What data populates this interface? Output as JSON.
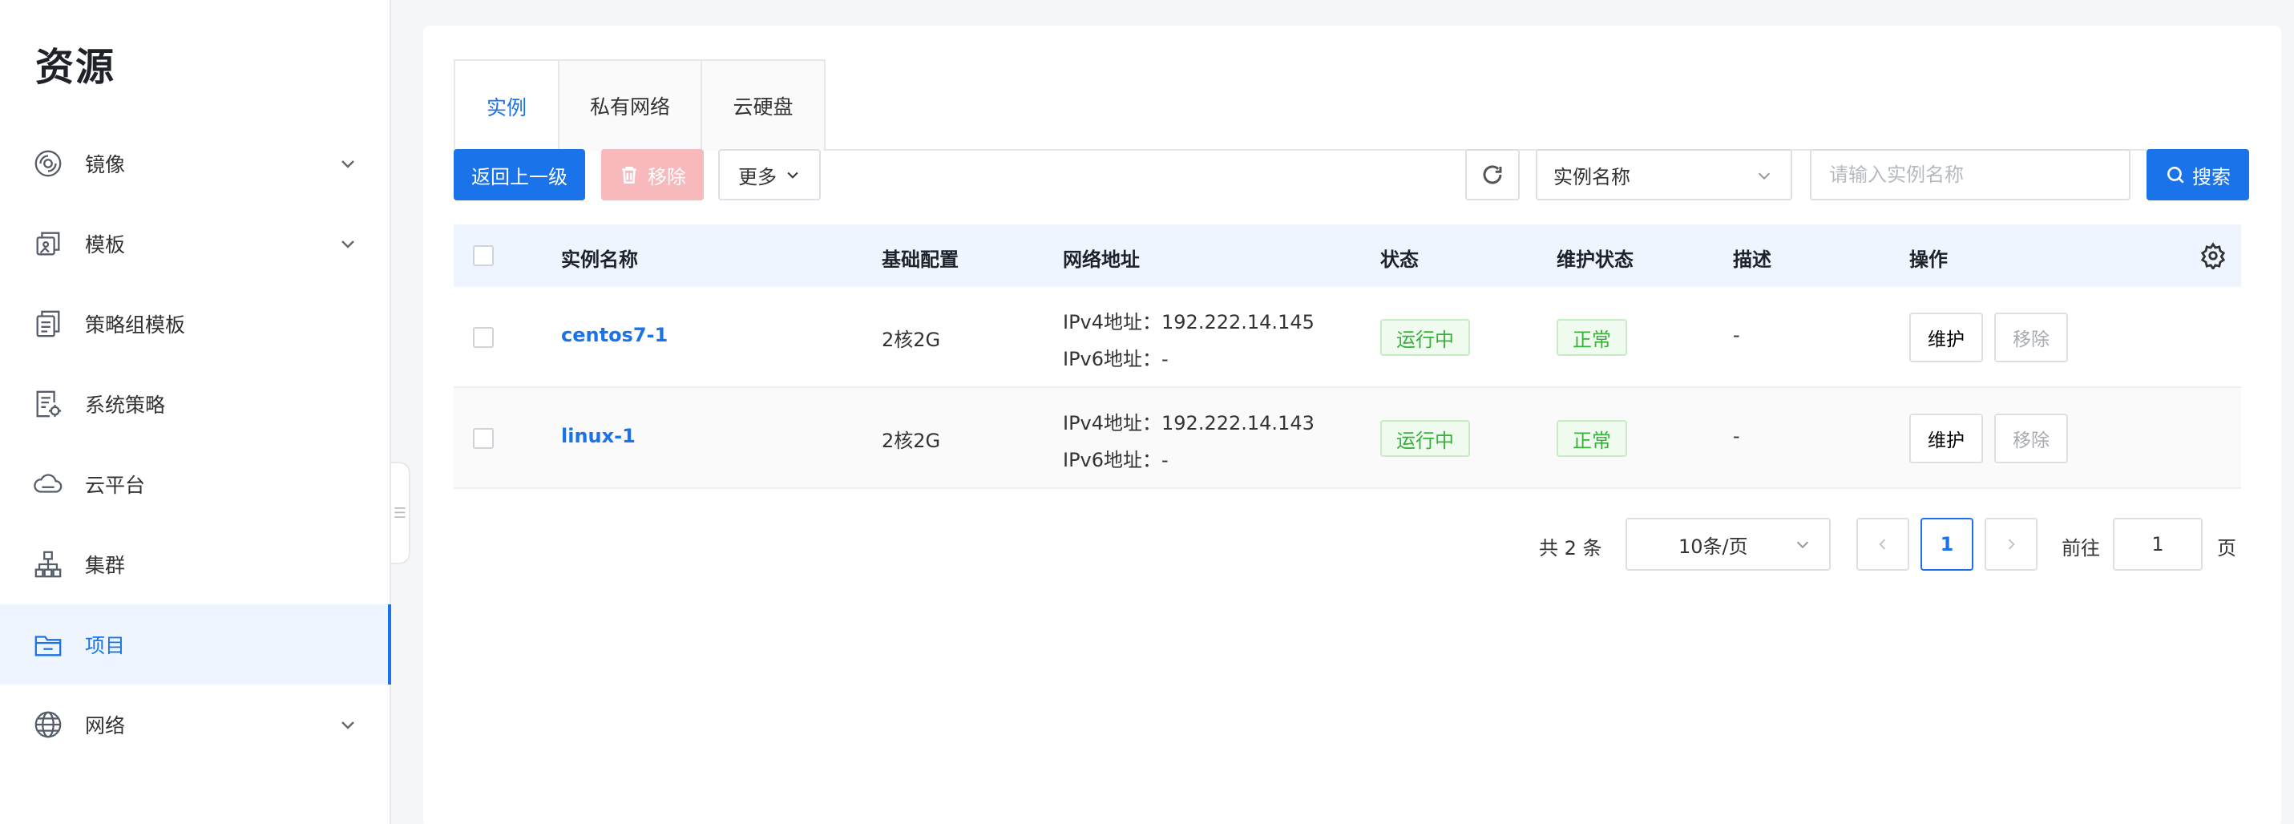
{
  "sidebar": {
    "title": "资源",
    "items": [
      {
        "label": "镜像",
        "icon": "disc-icon",
        "has_arrow": true
      },
      {
        "label": "模板",
        "icon": "template-icon",
        "has_arrow": true
      },
      {
        "label": "策略组模板",
        "icon": "policy-template-icon",
        "has_arrow": false
      },
      {
        "label": "系统策略",
        "icon": "system-policy-icon",
        "has_arrow": false
      },
      {
        "label": "云平台",
        "icon": "cloud-icon",
        "has_arrow": false
      },
      {
        "label": "集群",
        "icon": "cluster-icon",
        "has_arrow": false
      },
      {
        "label": "项目",
        "icon": "folder-icon",
        "has_arrow": false,
        "active": true
      },
      {
        "label": "网络",
        "icon": "globe-icon",
        "has_arrow": true
      }
    ]
  },
  "tabs": [
    {
      "label": "实例",
      "active": true
    },
    {
      "label": "私有网络"
    },
    {
      "label": "云硬盘"
    }
  ],
  "toolbar": {
    "back_label": "返回上一级",
    "remove_label": "移除",
    "more_label": "更多",
    "search_field_selected": "实例名称",
    "search_placeholder": "请输入实例名称",
    "search_label": "搜索"
  },
  "table": {
    "headers": {
      "name": "实例名称",
      "config": "基础配置",
      "network": "网络地址",
      "status": "状态",
      "maintenance": "维护状态",
      "description": "描述",
      "actions": "操作"
    },
    "rows": [
      {
        "name": "centos7-1",
        "config": "2核2G",
        "ipv4": "IPv4地址：192.222.14.145",
        "ipv6": "IPv6地址：-",
        "status": "运行中",
        "maintenance": "正常",
        "description": "-",
        "action_maintain": "维护",
        "action_remove": "移除"
      },
      {
        "name": "linux-1",
        "config": "2核2G",
        "ipv4": "IPv4地址：192.222.14.143",
        "ipv6": "IPv6地址：-",
        "status": "运行中",
        "maintenance": "正常",
        "description": "-",
        "action_maintain": "维护",
        "action_remove": "移除"
      }
    ]
  },
  "pagination": {
    "total": "共 2 条",
    "page_size": "10条/页",
    "current_page": "1",
    "goto_label": "前往",
    "goto_value": "1",
    "page_suffix": "页"
  },
  "colors": {
    "primary": "#1a73e8",
    "success": "#38b03a",
    "danger_disabled": "#f7b9bb"
  }
}
